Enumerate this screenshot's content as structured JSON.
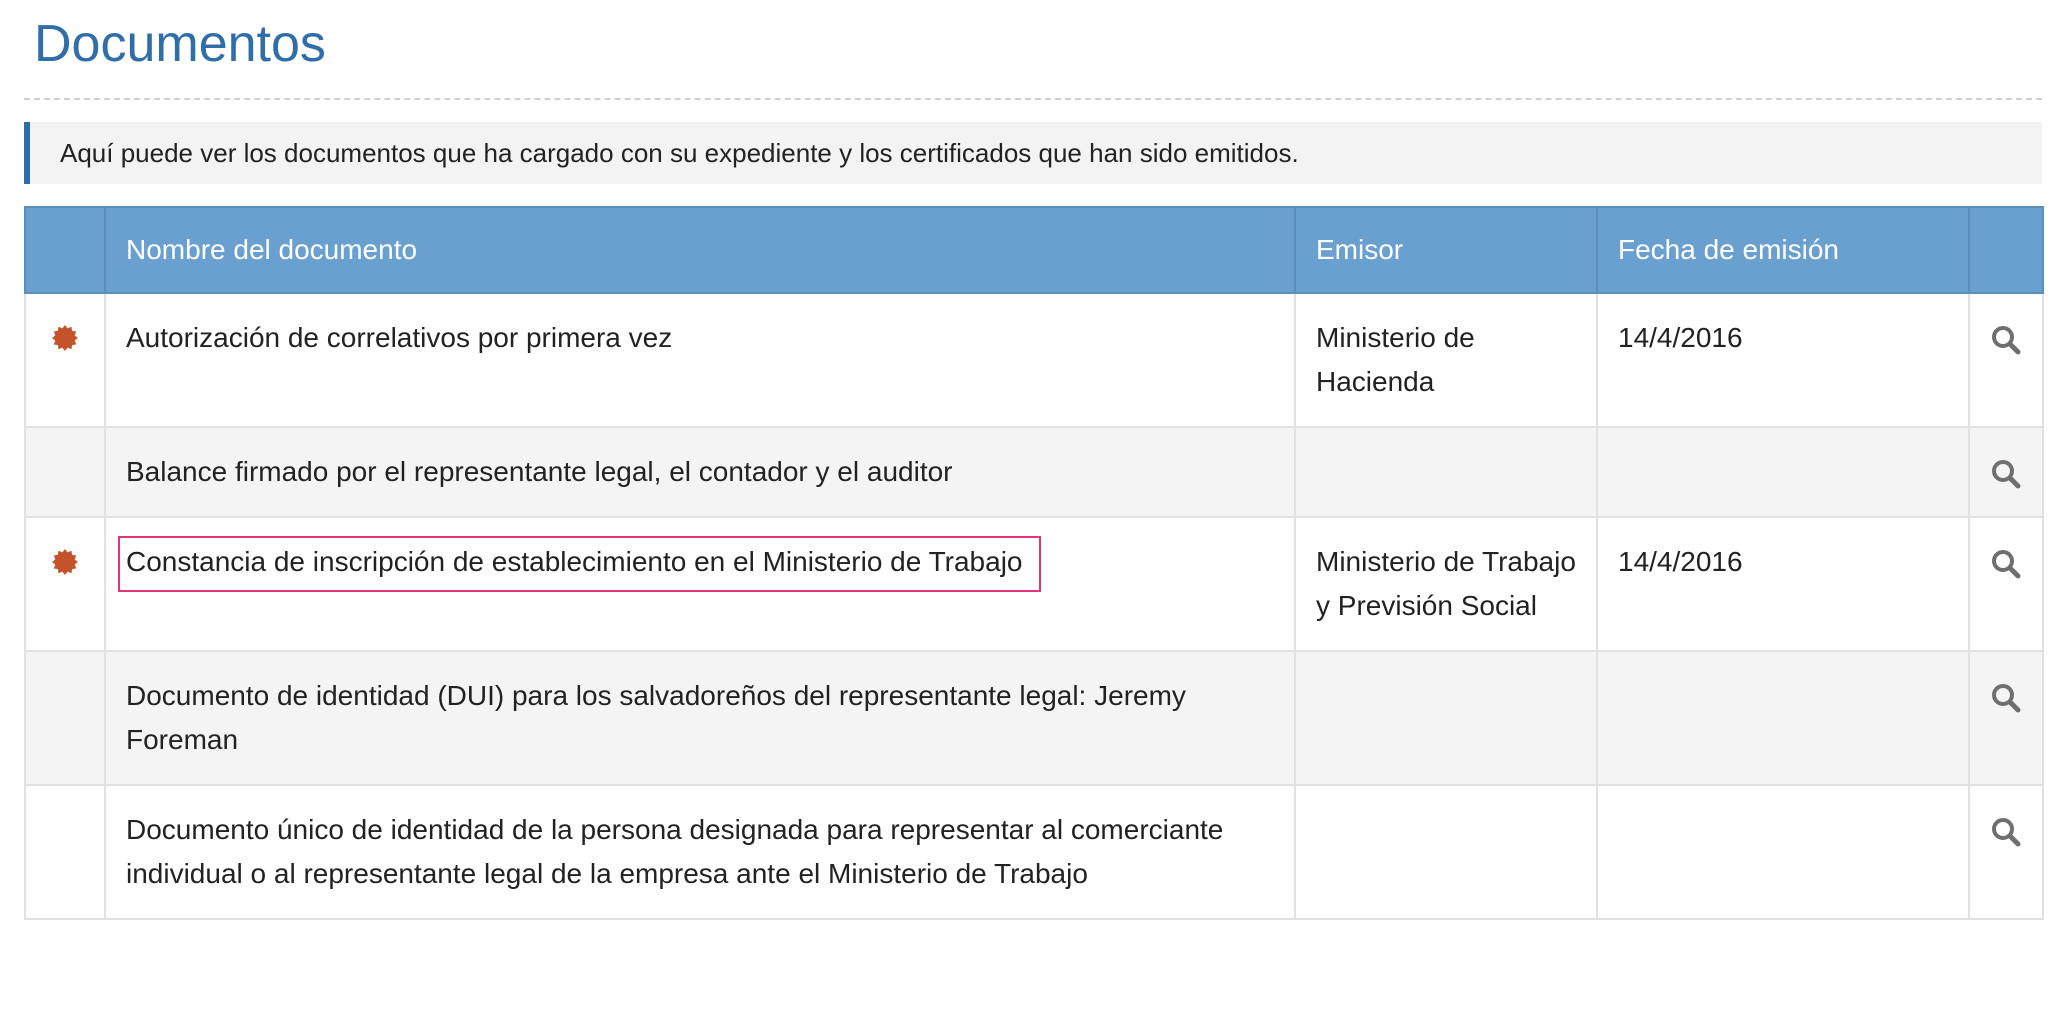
{
  "page": {
    "title": "Documentos",
    "info_text": "Aquí puede ver los documentos que ha cargado con su expediente y los certificados que han sido emitidos."
  },
  "table": {
    "headers": {
      "name": "Nombre del documento",
      "issuer": "Emisor",
      "date": "Fecha de emisión"
    },
    "rows": [
      {
        "certified": true,
        "name": "Autorización de correlativos por primera vez",
        "issuer": "Ministerio de Hacienda",
        "date": "14/4/2016",
        "highlighted": false
      },
      {
        "certified": false,
        "name": "Balance firmado por el representante legal, el contador y el auditor",
        "issuer": "",
        "date": "",
        "highlighted": false
      },
      {
        "certified": true,
        "name": "Constancia de inscripción de establecimiento en el Ministerio de Trabajo",
        "issuer": "Ministerio de Trabajo y Previsión Social",
        "date": "14/4/2016",
        "highlighted": true
      },
      {
        "certified": false,
        "name": "Documento de identidad (DUI) para los salvadoreños del representante legal: Jeremy Foreman",
        "issuer": "",
        "date": "",
        "highlighted": false
      },
      {
        "certified": false,
        "name": "Documento único de identidad de la persona designada para representar al comerciante individual o al representante legal de la empresa ante el Ministerio de Trabajo",
        "issuer": "",
        "date": "",
        "highlighted": false
      }
    ]
  },
  "icons": {
    "certified_badge": "certificate-seal-icon",
    "view_action": "search-icon"
  },
  "colors": {
    "title": "#2f6ea8",
    "header_background": "#6aa0cf",
    "badge": "#c4532b",
    "highlight_border": "#e0357a",
    "alt_row": "#f4f4f4"
  }
}
